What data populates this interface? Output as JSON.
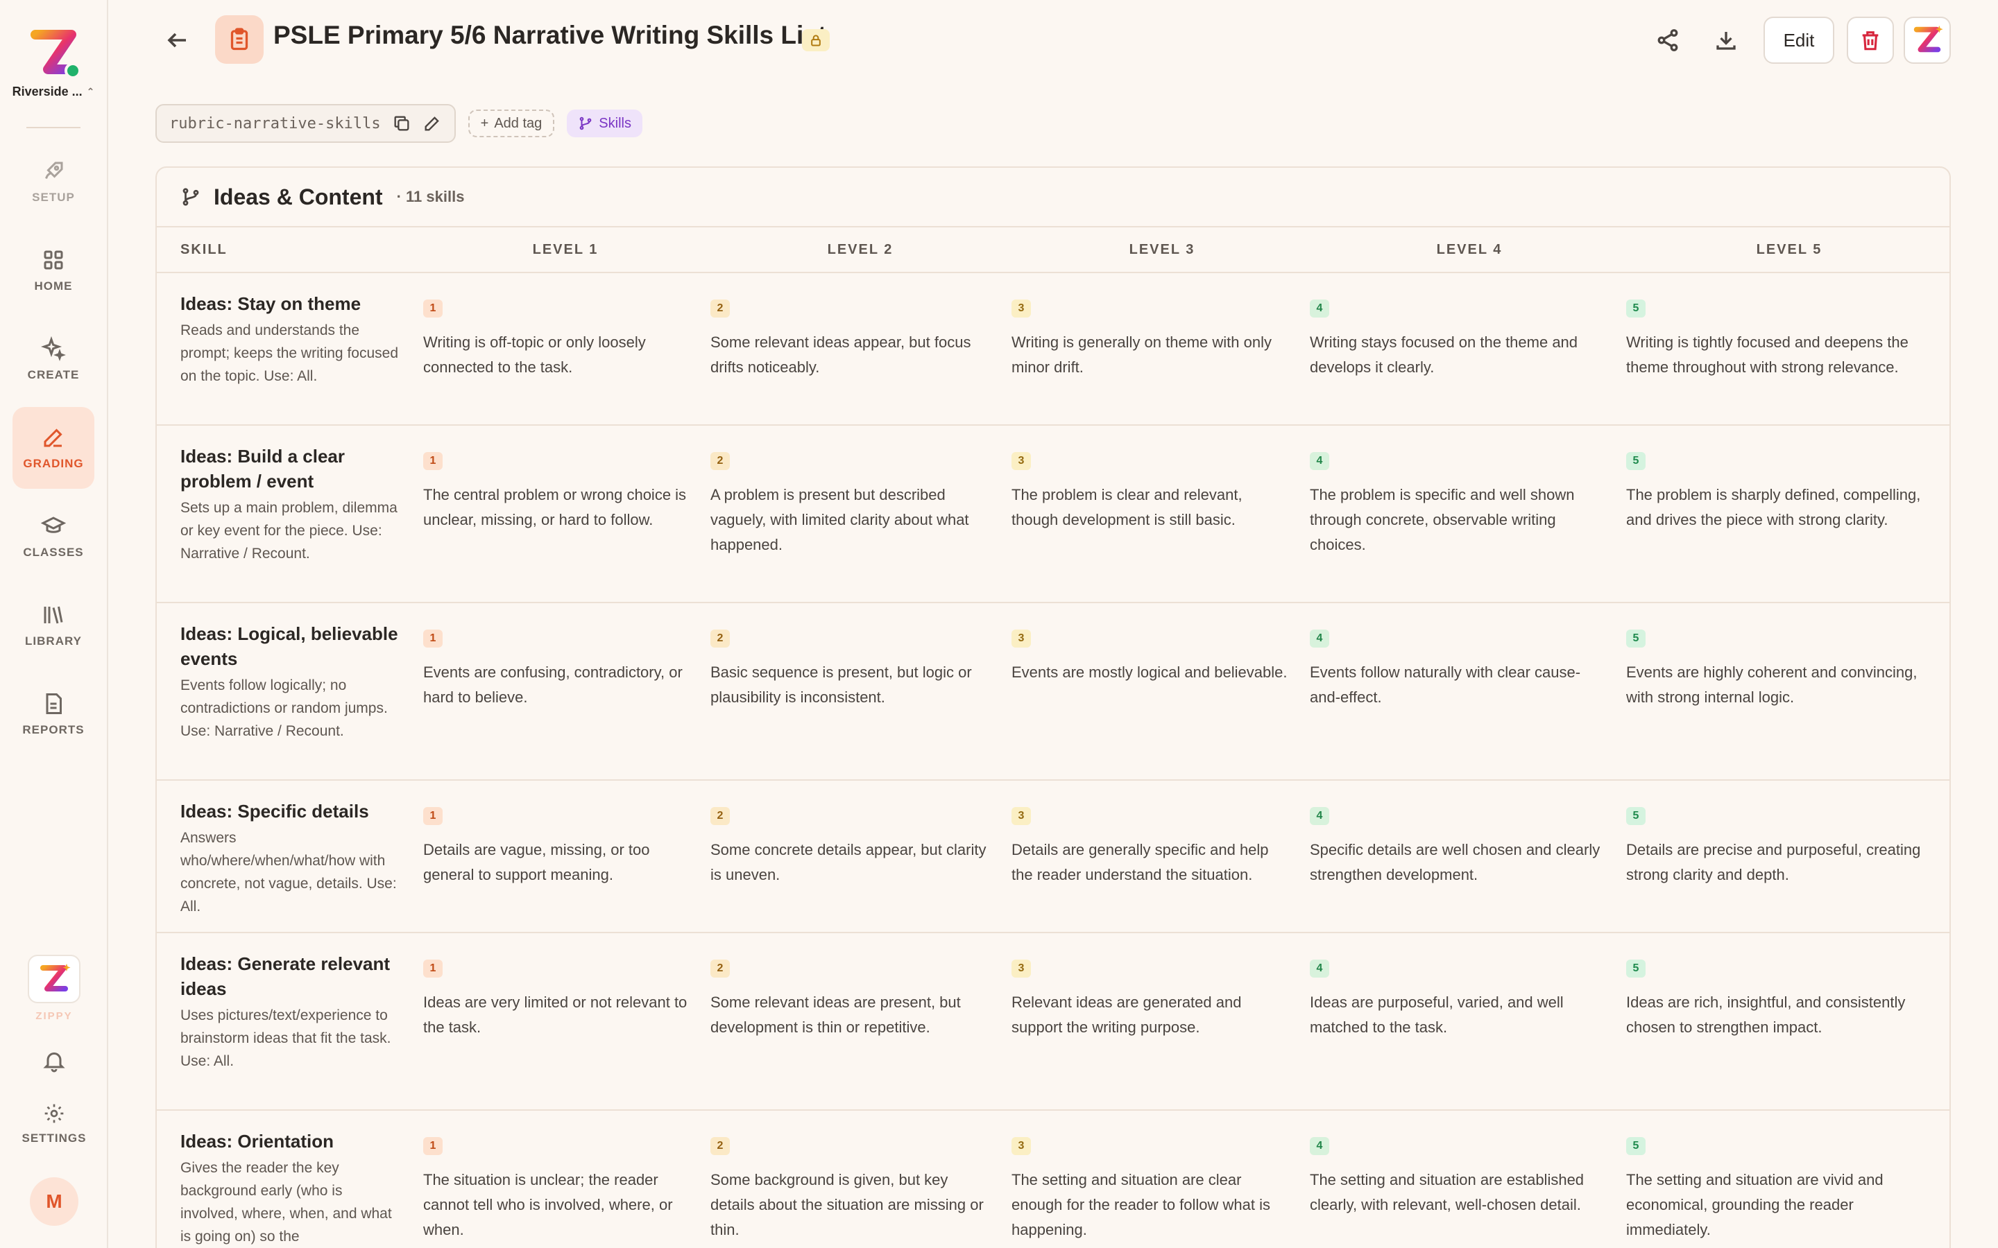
{
  "sidebar": {
    "org_name": "Riverside ...",
    "items": [
      {
        "label": "SETUP",
        "icon": "rocket-icon"
      },
      {
        "label": "HOME",
        "icon": "grid-icon"
      },
      {
        "label": "CREATE",
        "icon": "sparkles-icon"
      },
      {
        "label": "GRADING",
        "icon": "pen-icon"
      },
      {
        "label": "CLASSES",
        "icon": "graduation-cap-icon"
      },
      {
        "label": "LIBRARY",
        "icon": "books-icon"
      },
      {
        "label": "REPORTS",
        "icon": "report-icon"
      }
    ],
    "active_item": "GRADING",
    "zippy_label": "ZIPPY",
    "settings_label": "SETTINGS",
    "avatar_initial": "M"
  },
  "header": {
    "title": "PSLE Primary 5/6 Narrative Writing Skills List",
    "edit_label": "Edit"
  },
  "tags": {
    "slug": "rubric-narrative-skills",
    "add_tag_label": "Add tag",
    "type_chip": "Skills"
  },
  "section": {
    "title": "Ideas & Content",
    "count": "· 11 skills",
    "columns": [
      "SKILL",
      "LEVEL 1",
      "LEVEL 2",
      "LEVEL 3",
      "LEVEL 4",
      "LEVEL 5"
    ],
    "rows": [
      {
        "name": "Ideas: Stay on theme",
        "desc": "Reads and understands the prompt; keeps the writing focused on the topic. Use: All.",
        "levels": [
          "Writing is off-topic or only loosely connected to the task.",
          "Some relevant ideas appear, but focus drifts noticeably.",
          "Writing is generally on theme with only minor drift.",
          "Writing stays focused on the theme and develops it clearly.",
          "Writing is tightly focused and deepens the theme throughout with strong relevance."
        ]
      },
      {
        "name": "Ideas: Build a clear problem / event",
        "desc": "Sets up a main problem, dilemma or key event for the piece. Use: Narrative / Recount.",
        "levels": [
          "The central problem or wrong choice is unclear, missing, or hard to follow.",
          "A problem is present but described vaguely, with limited clarity about what happened.",
          "The problem is clear and relevant, though development is still basic.",
          "The problem is specific and well shown through concrete, observable writing choices.",
          "The problem is sharply defined, compelling, and drives the piece with strong clarity."
        ]
      },
      {
        "name": "Ideas: Logical, believable events",
        "desc": "Events follow logically; no contradictions or random jumps. Use: Narrative / Recount.",
        "levels": [
          "Events are confusing, contradictory, or hard to believe.",
          "Basic sequence is present, but logic or plausibility is inconsistent.",
          "Events are mostly logical and believable.",
          "Events follow naturally with clear cause-and-effect.",
          "Events are highly coherent and convincing, with strong internal logic."
        ]
      },
      {
        "name": "Ideas: Specific details",
        "desc": "Answers who/where/when/what/how with concrete, not vague, details. Use: All.",
        "levels": [
          "Details are vague, missing, or too general to support meaning.",
          "Some concrete details appear, but clarity is uneven.",
          "Details are generally specific and help the reader understand the situation.",
          "Specific details are well chosen and clearly strengthen development.",
          "Details are precise and purposeful, creating strong clarity and depth."
        ]
      },
      {
        "name": "Ideas: Generate relevant ideas",
        "desc": "Uses pictures/text/experience to brainstorm ideas that fit the task. Use: All.",
        "levels": [
          "Ideas are very limited or not relevant to the task.",
          "Some relevant ideas are present, but development is thin or repetitive.",
          "Relevant ideas are generated and support the writing purpose.",
          "Ideas are purposeful, varied, and well matched to the task.",
          "Ideas are rich, insightful, and consistently chosen to strengthen impact."
        ]
      },
      {
        "name": "Ideas: Orientation",
        "desc": "Gives the reader the key background early (who is involved, where, when, and what is going on) so the",
        "levels": [
          "The situation is unclear; the reader cannot tell who is involved, where, or when.",
          "Some background is given, but key details about the situation are missing or thin.",
          "The setting and situation are clear enough for the reader to follow what is happening.",
          "The setting and situation are established clearly, with relevant, well-chosen detail.",
          "The setting and situation are vivid and economical, grounding the reader immediately."
        ]
      }
    ]
  },
  "colors": {
    "accent": "#e0562b",
    "background": "#fcf7f2",
    "skills_chip": "#7a35c4",
    "delete": "#d7263d"
  }
}
